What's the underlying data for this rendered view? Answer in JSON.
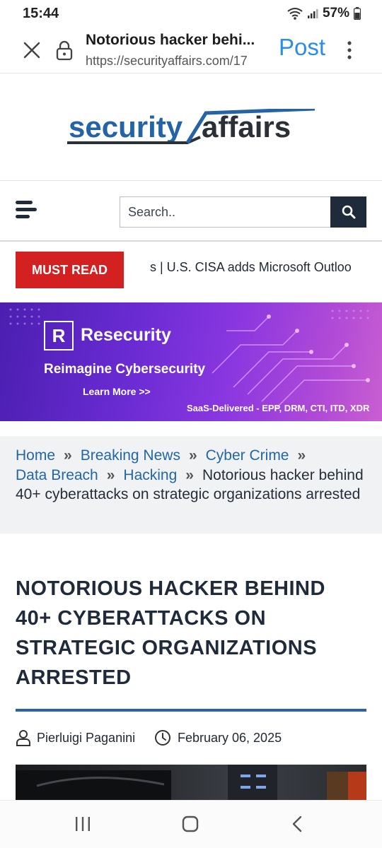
{
  "status_bar": {
    "time": "15:44",
    "battery": "57%"
  },
  "browser": {
    "page_title": "Notorious hacker behi...",
    "url": "https://securityaffairs.com/17",
    "post_label": "Post"
  },
  "site": {
    "logo_text_left": "security",
    "logo_text_right": "affairs"
  },
  "search": {
    "placeholder": "Search.."
  },
  "must_read": {
    "label": "MUST READ",
    "ticker": "s  |  U.S. CISA adds Microsoft Outloo"
  },
  "banner": {
    "brand": "Resecurity",
    "tagline": "Reimagine Cybersecurity",
    "cta": "Learn More >>",
    "footer": "SaaS-Delivered - EPP, DRM, CTI, ITD, XDR"
  },
  "breadcrumb": {
    "items": [
      "Home",
      "Breaking News",
      "Cyber Crime",
      "Data Breach",
      "Hacking"
    ],
    "current": "Notorious hacker behind 40+ cyberattacks on strategic organizations arrested"
  },
  "article": {
    "title": "NOTORIOUS HACKER BEHIND 40+ CYBERATTACKS ON STRATEGIC ORGANIZATIONS ARRESTED",
    "author": "Pierluigi Paganini",
    "date": "February 06, 2025"
  },
  "colors": {
    "accent_blue": "#2366a8",
    "must_read_red": "#d32121",
    "dark_navy": "#1f2a3a",
    "browser_post_blue": "#2a8de6"
  }
}
